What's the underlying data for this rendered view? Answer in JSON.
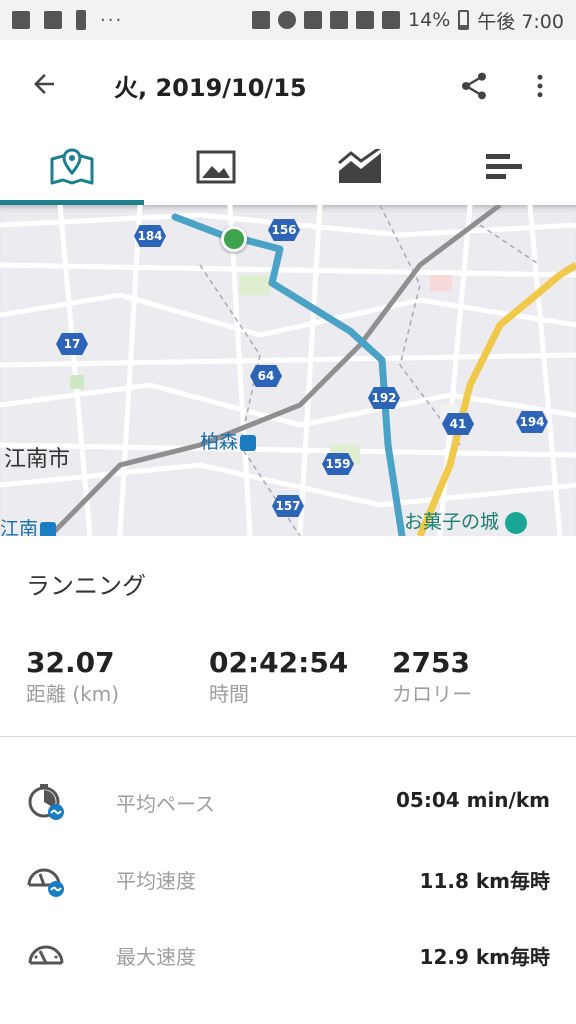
{
  "status_bar": {
    "battery": "14%",
    "time": "午後 7:00",
    "more": "···"
  },
  "header": {
    "title": "火, 2019/10/15"
  },
  "tabs": [
    {
      "name": "map",
      "icon": "map-icon"
    },
    {
      "name": "photos",
      "icon": "image-icon"
    },
    {
      "name": "charts",
      "icon": "chart-icon"
    },
    {
      "name": "details",
      "icon": "bars-icon"
    }
  ],
  "map": {
    "place_labels": {
      "city": "江南市",
      "station1": "柏森",
      "station2": "江南",
      "poi": "お菓子の城"
    },
    "road_numbers": [
      "184",
      "156",
      "17",
      "64",
      "192",
      "41",
      "194",
      "159",
      "157"
    ],
    "route_color": "#4aa3c6"
  },
  "activity": {
    "type": "ランニング",
    "stats": [
      {
        "value": "32.07",
        "label": "距離 (km)"
      },
      {
        "value": "02:42:54",
        "label": "時間"
      },
      {
        "value": "2753",
        "label": "カロリー"
      }
    ],
    "metrics": [
      {
        "label": "平均ペース",
        "value": "05:04 min/km",
        "icon": "pace-icon"
      },
      {
        "label": "平均速度",
        "value": "11.8 km毎時",
        "icon": "avg-speed-icon"
      },
      {
        "label": "最大速度",
        "value": "12.9 km毎時",
        "icon": "max-speed-icon"
      }
    ]
  },
  "colors": {
    "accent": "#1e7f8f",
    "road_badge": "#2d64b8",
    "start_marker": "#3fa34d"
  }
}
